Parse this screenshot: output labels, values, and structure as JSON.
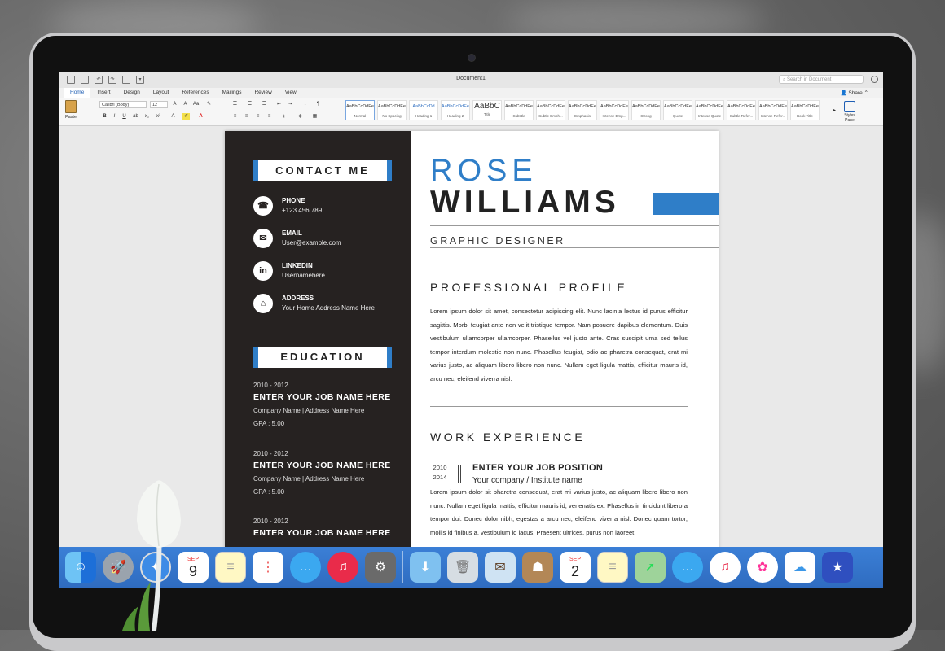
{
  "window": {
    "doc_title": "Document1"
  },
  "search": {
    "placeholder": "Search in Document"
  },
  "share": "Share",
  "tabs": [
    "Home",
    "Insert",
    "Design",
    "Layout",
    "References",
    "Mailings",
    "Review",
    "View"
  ],
  "ribbon": {
    "paste_label": "Paste",
    "font_name": "Calibri (Body)",
    "font_size": "12",
    "styles": [
      {
        "sample": "AaBbCcDdEe",
        "name": "Normal"
      },
      {
        "sample": "AaBbCcDdEe",
        "name": "No Spacing"
      },
      {
        "sample": "AaBbCcDd",
        "name": "Heading 1"
      },
      {
        "sample": "AaBbCcDdEe",
        "name": "Heading 2"
      },
      {
        "sample": "AaBbC",
        "name": "Title"
      },
      {
        "sample": "AaBbCcDdEe",
        "name": "Subtitle"
      },
      {
        "sample": "AaBbCcDdEe",
        "name": "Subtle Emph..."
      },
      {
        "sample": "AaBbCcDdEe",
        "name": "Emphasis"
      },
      {
        "sample": "AaBbCcDdEe",
        "name": "Intense Emp..."
      },
      {
        "sample": "AaBbCcDdEe",
        "name": "Strong"
      },
      {
        "sample": "AaBbCcDdEe",
        "name": "Quote"
      },
      {
        "sample": "AaBbCcDdEe",
        "name": "Intense Quote"
      },
      {
        "sample": "AaBbCcDdEe",
        "name": "Subtle Refer..."
      },
      {
        "sample": "AaBbCcDdEe",
        "name": "Intense Refer..."
      },
      {
        "sample": "AaBbCcDdEe",
        "name": "Book Title"
      }
    ],
    "styles_pane_label": "Styles Pane"
  },
  "resume": {
    "contact_heading": "CONTACT ME",
    "contacts": [
      {
        "label": "PHONE",
        "value": "+123 456 789",
        "icon": "phone-icon"
      },
      {
        "label": "EMAIL",
        "value": "User@example.com",
        "icon": "email-icon"
      },
      {
        "label": "LINKEDIN",
        "value": "Usernamehere",
        "icon": "linkedin-icon"
      },
      {
        "label": "ADDRESS",
        "value": "Your Home Address Name Here",
        "icon": "home-icon"
      }
    ],
    "education_heading": "EDUCATION",
    "education": [
      {
        "years": "2010 - 2012",
        "job": "ENTER YOUR JOB NAME HERE",
        "company": "Company Name |  Address Name Here",
        "gpa": "GPA : 5.00"
      },
      {
        "years": "2010 - 2012",
        "job": "ENTER YOUR JOB NAME HERE",
        "company": "Company Name |  Address Name Here",
        "gpa": "GPA : 5.00"
      },
      {
        "years": "2010 - 2012",
        "job": "ENTER YOUR JOB NAME HERE",
        "company": "",
        "gpa": ""
      }
    ],
    "first_name": "ROSE",
    "last_name": "WILLIAMS",
    "job_title": "GRAPHIC DESIGNER",
    "profile_heading": "PROFESSIONAL PROFILE",
    "profile_text": "Lorem ipsum dolor sit amet, consectetur adipiscing elit. Nunc lacinia lectus id purus efficitur sagittis. Morbi feugiat ante non velit tristique tempor. Nam posuere dapibus elementum. Duis vestibulum ullamcorper ullamcorper. Phasellus vel justo ante. Cras suscipit urna sed tellus tempor interdum molestie non nunc. Phasellus feugiat, odio ac pharetra consequat, erat mi varius justo, ac aliquam libero libero non nunc. Nullam eget ligula mattis, efficitur mauris id, arcu nec, eleifend viverra nisl.",
    "work_heading": "WORK EXPERIENCE",
    "work": {
      "year_start": "2010",
      "year_end": "2014",
      "position": "ENTER YOUR JOB POSITION",
      "company": "Your company / Institute name",
      "text": "Lorem ipsum dolor sit pharetra consequat, erat mi varius justo, ac aliquam libero libero non nunc. Nullam eget ligula mattis, efficitur mauris id, venenatis ex. Phasellus in tincidunt libero a tempor dui. Donec dolor nibh, egestas a arcu nec, eleifend viverra nisl. Donec quam tortor, mollis id finibus a, vestibulum id lacus. Praesent ultrices, purus non laoreet"
    }
  },
  "dock": {
    "calendar_month_1": "SEP",
    "calendar_day_1": "9",
    "calendar_month_2": "SEP",
    "calendar_day_2": "2",
    "icons": [
      "finder-icon",
      "launchpad-icon",
      "safari-icon",
      "calendar-icon",
      "notes-icon",
      "reminders-icon",
      "messages-icon",
      "itunes-icon",
      "system-preferences-icon",
      "downloads-folder-icon",
      "trash-icon",
      "mail-stamp-icon",
      "contacts-icon",
      "calendar-icon",
      "notes-icon",
      "maps-icon",
      "messages-icon",
      "music-icon",
      "photos-icon",
      "icloud-icon",
      "imovie-icon"
    ]
  },
  "colors": {
    "accent": "#2f7ec8",
    "sidebar": "#262221",
    "dock": "#3b7fd6"
  }
}
